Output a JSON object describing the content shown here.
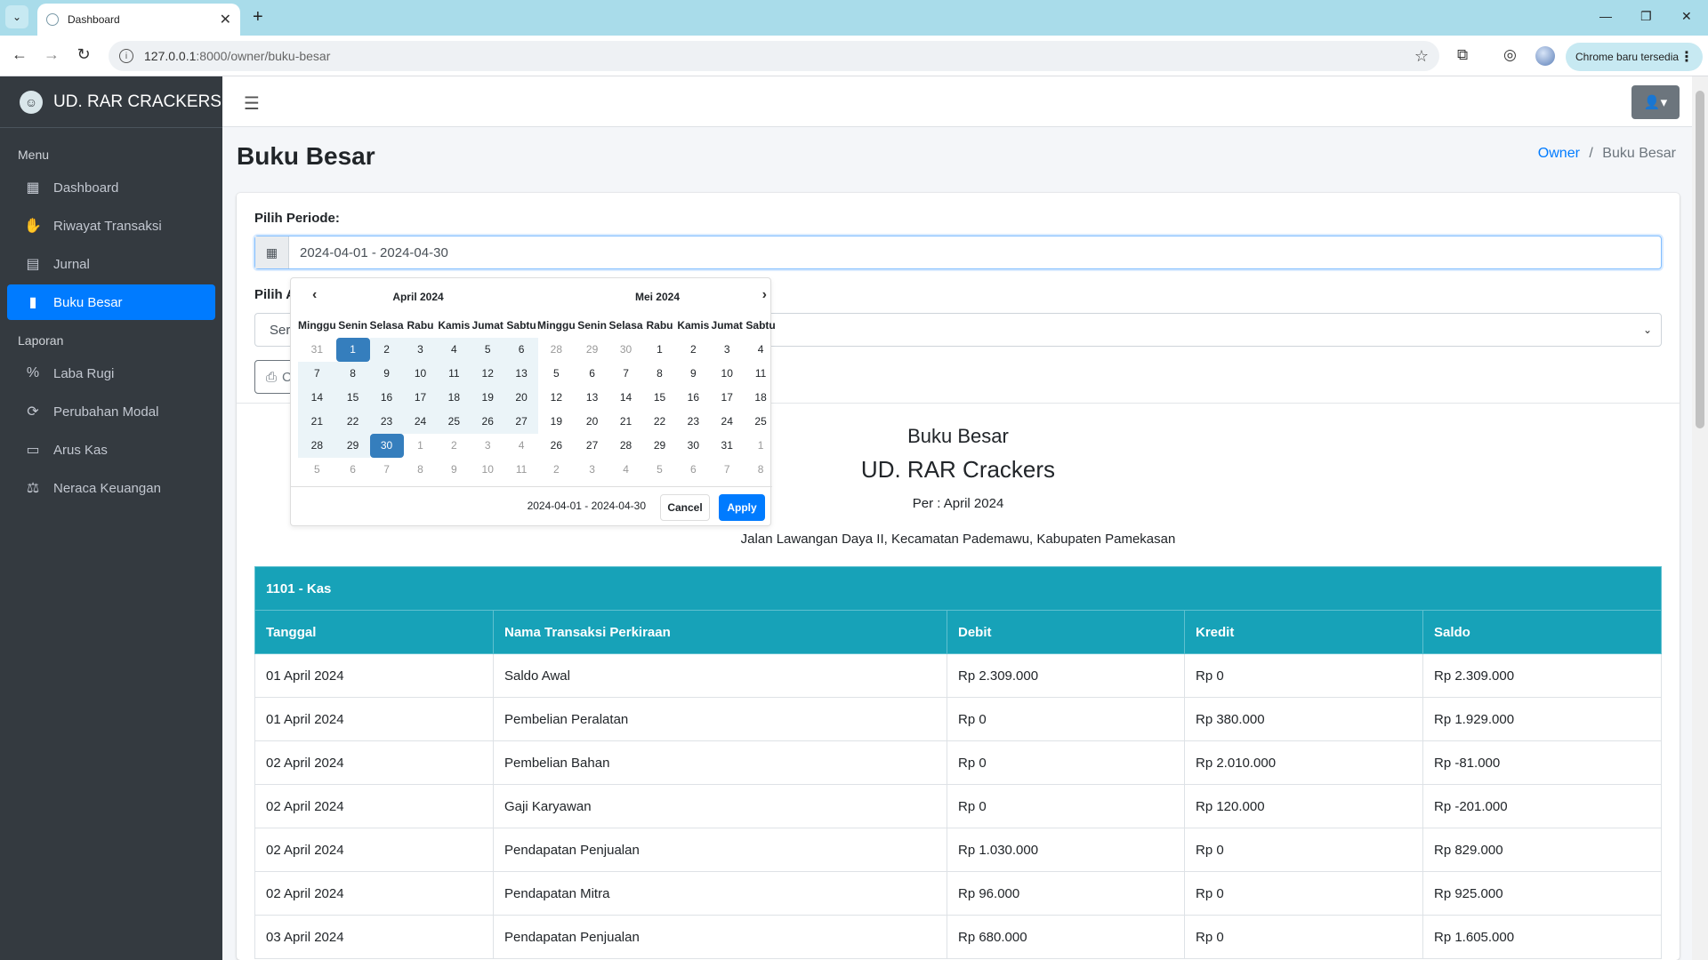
{
  "browser": {
    "tab_title": "Dashboard",
    "url_host": "127.0.0.1",
    "url_rest": ":8000/owner/buku-besar",
    "update_label": "Chrome baru tersedia"
  },
  "sidebar": {
    "brand": "UD. RAR CRACKERS",
    "menu_header": "Menu",
    "report_header": "Laporan",
    "items": [
      {
        "label": "Dashboard",
        "icon": "dashboard-icon"
      },
      {
        "label": "Riwayat Transaksi",
        "icon": "handshake-icon"
      },
      {
        "label": "Jurnal",
        "icon": "journal-icon"
      },
      {
        "label": "Buku Besar",
        "icon": "book-icon",
        "active": true
      }
    ],
    "report_items": [
      {
        "label": "Laba Rugi",
        "icon": "percent-icon"
      },
      {
        "label": "Perubahan Modal",
        "icon": "sync-icon"
      },
      {
        "label": "Arus Kas",
        "icon": "money-icon"
      },
      {
        "label": "Neraca Keuangan",
        "icon": "scale-icon"
      }
    ]
  },
  "page": {
    "title": "Buku Besar",
    "breadcrumb_home": "Owner",
    "breadcrumb_sep": "/",
    "breadcrumb_current": "Buku Besar"
  },
  "filter": {
    "period_label": "Pilih Periode:",
    "period_value": "2024-04-01 - 2024-04-30",
    "account_label_visible": "Pilih A",
    "account_select_visible": "Ser",
    "print_visible": "C"
  },
  "picker": {
    "left_month": "April 2024",
    "right_month": "Mei 2024",
    "dow": [
      "Minggu",
      "Senin",
      "Selasa",
      "Rabu",
      "Kamis",
      "Jumat",
      "Sabtu"
    ],
    "left_days": [
      [
        "31",
        "1",
        "2",
        "3",
        "4",
        "5",
        "6"
      ],
      [
        "7",
        "8",
        "9",
        "10",
        "11",
        "12",
        "13"
      ],
      [
        "14",
        "15",
        "16",
        "17",
        "18",
        "19",
        "20"
      ],
      [
        "21",
        "22",
        "23",
        "24",
        "25",
        "26",
        "27"
      ],
      [
        "28",
        "29",
        "30",
        "1",
        "2",
        "3",
        "4"
      ],
      [
        "5",
        "6",
        "7",
        "8",
        "9",
        "10",
        "11"
      ]
    ],
    "right_days": [
      [
        "28",
        "29",
        "30",
        "1",
        "2",
        "3",
        "4"
      ],
      [
        "5",
        "6",
        "7",
        "8",
        "9",
        "10",
        "11"
      ],
      [
        "12",
        "13",
        "14",
        "15",
        "16",
        "17",
        "18"
      ],
      [
        "19",
        "20",
        "21",
        "22",
        "23",
        "24",
        "25"
      ],
      [
        "26",
        "27",
        "28",
        "29",
        "30",
        "31",
        "1"
      ],
      [
        "2",
        "3",
        "4",
        "5",
        "6",
        "7",
        "8"
      ]
    ],
    "selected_range": "2024-04-01 - 2024-04-30",
    "cancel_label": "Cancel",
    "apply_label": "Apply"
  },
  "report": {
    "title": "Buku Besar",
    "company": "UD. RAR Crackers",
    "period": "Per : April 2024",
    "address": "Jalan Lawangan Daya II, Kecamatan Pademawu, Kabupaten Pamekasan"
  },
  "ledger": {
    "account": "1101 - Kas",
    "columns": [
      "Tanggal",
      "Nama Transaksi Perkiraan",
      "Debit",
      "Kredit",
      "Saldo"
    ],
    "rows": [
      [
        "01 April 2024",
        "Saldo Awal",
        "Rp 2.309.000",
        "Rp 0",
        "Rp 2.309.000"
      ],
      [
        "01 April 2024",
        "Pembelian Peralatan",
        "Rp 0",
        "Rp 380.000",
        "Rp 1.929.000"
      ],
      [
        "02 April 2024",
        "Pembelian Bahan",
        "Rp 0",
        "Rp 2.010.000",
        "Rp -81.000"
      ],
      [
        "02 April 2024",
        "Gaji Karyawan",
        "Rp 0",
        "Rp 120.000",
        "Rp -201.000"
      ],
      [
        "02 April 2024",
        "Pendapatan Penjualan",
        "Rp 1.030.000",
        "Rp 0",
        "Rp 829.000"
      ],
      [
        "02 April 2024",
        "Pendapatan Mitra",
        "Rp 96.000",
        "Rp 0",
        "Rp 925.000"
      ],
      [
        "03 April 2024",
        "Pendapatan Penjualan",
        "Rp 680.000",
        "Rp 0",
        "Rp 1.605.000"
      ]
    ]
  },
  "colors": {
    "sidebar_bg": "#343a40",
    "active_blue": "#007bff",
    "table_header": "#17a2b8",
    "range_selected": "#357ebd"
  }
}
